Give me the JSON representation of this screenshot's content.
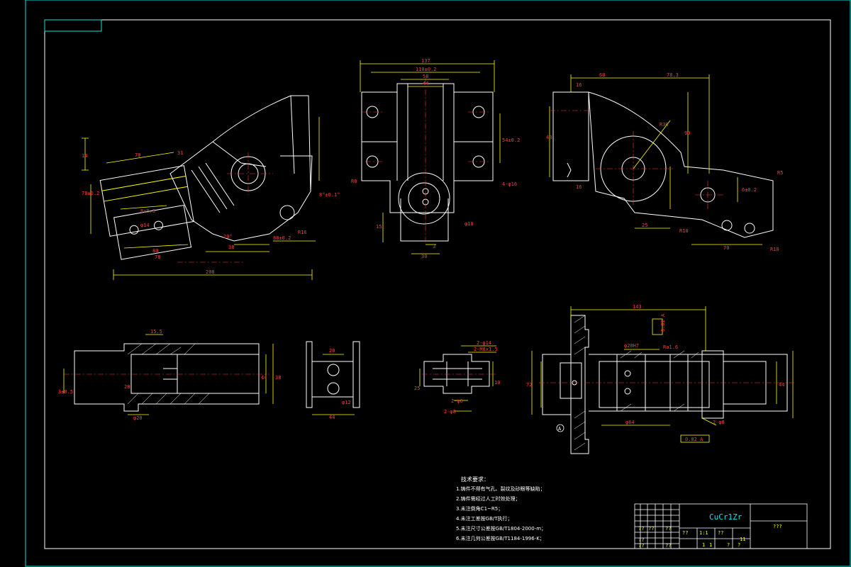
{
  "colors": {
    "background": "#000000",
    "frame": "#19e0e0",
    "geometry": "#ffffff",
    "dimension": "#ffff00",
    "dim_text": "#ff3b3b",
    "center": "#ff3b3b"
  },
  "view1": {
    "d_total": "208",
    "d_a": "70",
    "d_b": "31",
    "d_c": "14",
    "d_d": "78",
    "d_e": "80",
    "d_f": "8x0.5",
    "d_g": "78±0.2",
    "d_h": "38",
    "d_i": "20°",
    "d_j": "88±0.2",
    "d_k": "R16",
    "d_l": "8°±0.1°",
    "d_m": "φ14"
  },
  "view2": {
    "d_137": "137",
    "d_110": "110±0.2",
    "d_58": "58",
    "d_44": "44",
    "d_54": "54±0.2",
    "d_r": "R8",
    "d_4x": "4-φ16",
    "d_15": "15",
    "d_3": "3",
    "d_30": "30",
    "d_phi": "φ10"
  },
  "view3": {
    "d_60": "60",
    "d_783": "78.3",
    "d_16a": "16",
    "d_16b": "16",
    "d_90": "90",
    "d_48": "48",
    "d_r": "R36",
    "d_25": "25",
    "d_70": "70",
    "d_r5": "R5",
    "d_r10a": "R10",
    "d_r10b": "R10",
    "d_p": "6±0.2"
  },
  "view4": {
    "d_155": "15.5",
    "d_44": "44",
    "d_38": "38",
    "d_28": "28",
    "d_phi": "φ20",
    "d_3": "3±0.5"
  },
  "view5": {
    "d_20": "20",
    "d_44": "44",
    "d_phi": "φ12"
  },
  "view6": {
    "d_a": "2-φ14",
    "d_b": "2-M8x1.5",
    "d_c": "2-φ6",
    "d_d": "2-φ8",
    "d_e": "25",
    "d_f": "10"
  },
  "view7": {
    "d_143": "143",
    "d_phi20": "φ20H7",
    "d_tol": "0.02 A",
    "d_ra": "Ra1.6",
    "d_64": "φ64",
    "d_72": "72",
    "d_44": "44",
    "d_2x": "2-φ8",
    "d_ref": "A",
    "d_perp": "0.02 A"
  },
  "notes": {
    "title": "技术要求：",
    "lines": [
      "1.铸件不得有气孔、裂纹及砂眼等缺陷；",
      "2.铸件需经过人工时效处理；",
      "3.未注倒角C1~R5；",
      "4.未注工差按GB/T执行；",
      "5.未注尺寸公差按GB/T1804-2000-m；",
      "6.未注几何公差按GB/T1184-1996-K；"
    ]
  },
  "title_block": {
    "material": "CuCr1Zr",
    "drawing_name": "???",
    "scale": "1:1",
    "sheets": "11",
    "cells": [
      "??",
      "??",
      "??",
      "??",
      "??",
      "??",
      "??",
      "??",
      "1",
      "1",
      "?",
      "?"
    ]
  }
}
